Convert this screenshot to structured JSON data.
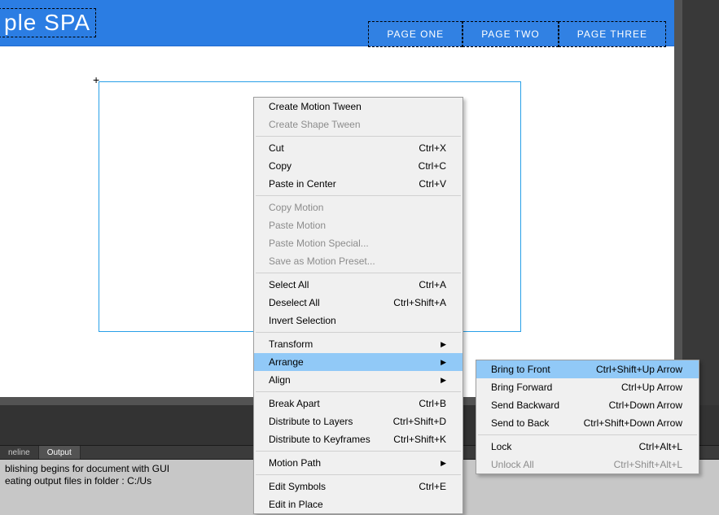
{
  "header": {
    "title": "ple SPA"
  },
  "nav": {
    "items": [
      "PAGE ONE",
      "PAGE TWO",
      "PAGE THREE"
    ]
  },
  "tabs": {
    "items": [
      "neline",
      "Output"
    ]
  },
  "output": {
    "lines": [
      "blishing begins for document with GUI",
      "eating output files in folder : C:/Us"
    ]
  },
  "menu1": {
    "groups": [
      [
        {
          "label": "Create Motion Tween"
        },
        {
          "label": "Create Shape Tween",
          "disabled": true
        }
      ],
      [
        {
          "label": "Cut",
          "shortcut": "Ctrl+X"
        },
        {
          "label": "Copy",
          "shortcut": "Ctrl+C"
        },
        {
          "label": "Paste in Center",
          "shortcut": "Ctrl+V"
        }
      ],
      [
        {
          "label": "Copy Motion",
          "disabled": true
        },
        {
          "label": "Paste Motion",
          "disabled": true
        },
        {
          "label": "Paste Motion Special...",
          "disabled": true
        },
        {
          "label": "Save as Motion Preset...",
          "disabled": true
        }
      ],
      [
        {
          "label": "Select All",
          "shortcut": "Ctrl+A"
        },
        {
          "label": "Deselect All",
          "shortcut": "Ctrl+Shift+A"
        },
        {
          "label": "Invert Selection"
        }
      ],
      [
        {
          "label": "Transform",
          "submenu": true
        },
        {
          "label": "Arrange",
          "submenu": true,
          "highlight": true
        },
        {
          "label": "Align",
          "submenu": true
        }
      ],
      [
        {
          "label": "Break Apart",
          "shortcut": "Ctrl+B"
        },
        {
          "label": "Distribute to Layers",
          "shortcut": "Ctrl+Shift+D"
        },
        {
          "label": "Distribute to Keyframes",
          "shortcut": "Ctrl+Shift+K"
        }
      ],
      [
        {
          "label": "Motion Path",
          "submenu": true
        }
      ],
      [
        {
          "label": "Edit Symbols",
          "shortcut": "Ctrl+E"
        },
        {
          "label": "Edit in Place"
        }
      ]
    ]
  },
  "menu2": {
    "groups": [
      [
        {
          "label": "Bring to Front",
          "shortcut": "Ctrl+Shift+Up Arrow",
          "highlight": true
        },
        {
          "label": "Bring Forward",
          "shortcut": "Ctrl+Up Arrow"
        },
        {
          "label": "Send Backward",
          "shortcut": "Ctrl+Down Arrow"
        },
        {
          "label": "Send to Back",
          "shortcut": "Ctrl+Shift+Down Arrow"
        }
      ],
      [
        {
          "label": "Lock",
          "shortcut": "Ctrl+Alt+L"
        },
        {
          "label": "Unlock All",
          "shortcut": "Ctrl+Shift+Alt+L",
          "disabled": true
        }
      ]
    ]
  }
}
